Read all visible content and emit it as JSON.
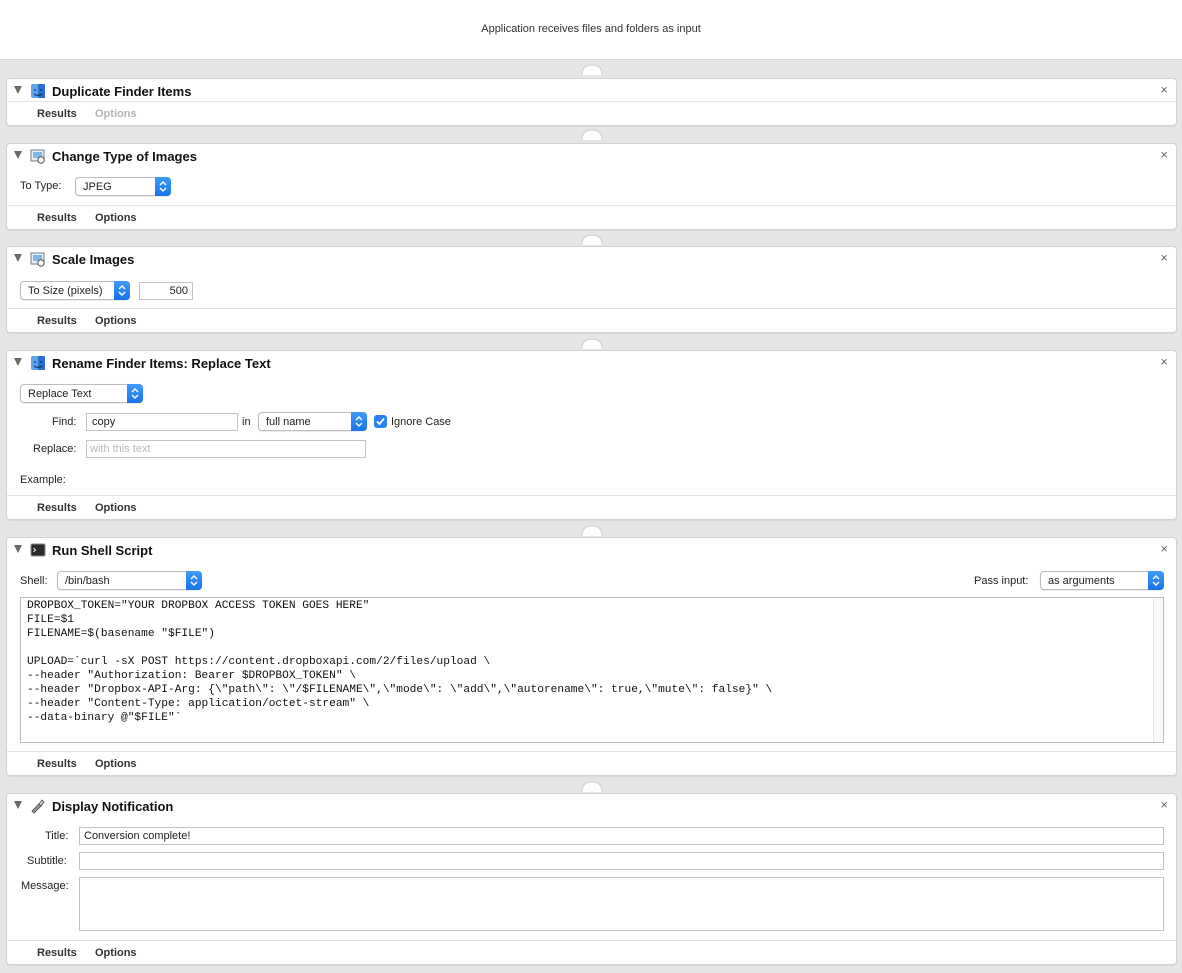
{
  "header": {
    "input_text": "Application receives files and folders as input"
  },
  "icons": {
    "disclosure": "disclosure-triangle-icon",
    "close": "close-icon",
    "finder": "finder-icon",
    "preview": "preview-icon",
    "terminal": "terminal-icon",
    "script_editor": "script-editor-icon",
    "popup_arrows": "chevron-up-down-icon",
    "check": "checkmark-icon"
  },
  "colors": {
    "accent": "#2d80f4",
    "canvas": "#e6e6e6",
    "card": "#ffffff"
  },
  "close_glyph": "×",
  "footer": {
    "results": "Results",
    "options": "Options"
  },
  "actions": {
    "duplicate": {
      "title": "Duplicate Finder Items"
    },
    "change_type": {
      "title": "Change Type of Images",
      "to_type_label": "To Type:",
      "to_type_value": "JPEG"
    },
    "scale": {
      "title": "Scale Images",
      "mode_value": "To Size (pixels)",
      "size_value": "500"
    },
    "rename": {
      "title": "Rename Finder Items: Replace Text",
      "mode_value": "Replace Text",
      "find_label": "Find:",
      "find_value": "copy",
      "in_label": "in",
      "in_value": "full name",
      "ignore_case_label": "Ignore Case",
      "ignore_case_checked": true,
      "replace_label": "Replace:",
      "replace_placeholder": "with this text",
      "example_label": "Example:"
    },
    "shell": {
      "title": "Run Shell Script",
      "shell_label": "Shell:",
      "shell_value": "/bin/bash",
      "pass_input_label": "Pass input:",
      "pass_input_value": "as arguments",
      "script": "DROPBOX_TOKEN=\"YOUR DROPBOX ACCESS TOKEN GOES HERE\"\nFILE=$1\nFILENAME=$(basename \"$FILE\")\n\nUPLOAD=`curl -sX POST https://content.dropboxapi.com/2/files/upload \\\n--header \"Authorization: Bearer $DROPBOX_TOKEN\" \\\n--header \"Dropbox-API-Arg: {\\\"path\\\": \\\"/$FILENAME\\\",\\\"mode\\\": \\\"add\\\",\\\"autorename\\\": true,\\\"mute\\\": false}\" \\\n--header \"Content-Type: application/octet-stream\" \\\n--data-binary @\"$FILE\"`"
    },
    "notify": {
      "title": "Display Notification",
      "title_label": "Title:",
      "title_value": "Conversion complete!",
      "subtitle_label": "Subtitle:",
      "subtitle_value": "",
      "message_label": "Message:",
      "message_value": ""
    }
  }
}
